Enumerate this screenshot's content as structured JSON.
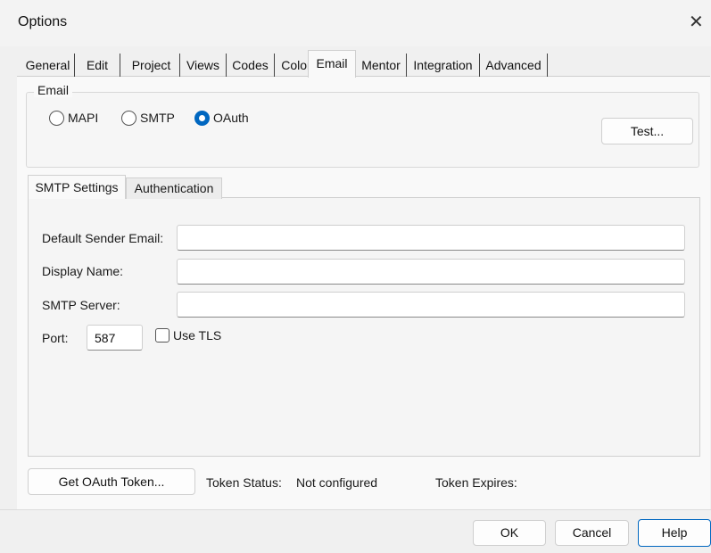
{
  "window": {
    "title": "Options",
    "close_glyph": "✕"
  },
  "tabs": [
    {
      "label": "General"
    },
    {
      "label": "Edit"
    },
    {
      "label": "Project"
    },
    {
      "label": "Views"
    },
    {
      "label": "Codes"
    },
    {
      "label": "Color"
    },
    {
      "label": "Email",
      "active": true
    },
    {
      "label": "Mentor"
    },
    {
      "label": "Integration"
    },
    {
      "label": "Advanced"
    }
  ],
  "email_group": {
    "label": "Email",
    "options": [
      {
        "label": "MAPI",
        "checked": false
      },
      {
        "label": "SMTP",
        "checked": false
      },
      {
        "label": "OAuth",
        "checked": true
      }
    ],
    "test_button": "Test..."
  },
  "subtabs": {
    "smtp": "SMTP Settings",
    "auth": "Authentication"
  },
  "smtp_settings": {
    "sender_label": "Default Sender Email:",
    "sender_value": "",
    "display_label": "Display Name:",
    "display_value": "",
    "server_label": "SMTP Server:",
    "server_value": "",
    "port_label": "Port:",
    "port_value": "587",
    "tls_label": "Use TLS",
    "tls_checked": false
  },
  "oauth": {
    "button": "Get OAuth Token...",
    "status_label": "Token Status:",
    "status_value": "Not configured",
    "expires_label": "Token Expires:"
  },
  "footer": {
    "ok": "OK",
    "cancel": "Cancel",
    "help": "Help"
  },
  "colors": {
    "accent": "#0067c0"
  }
}
